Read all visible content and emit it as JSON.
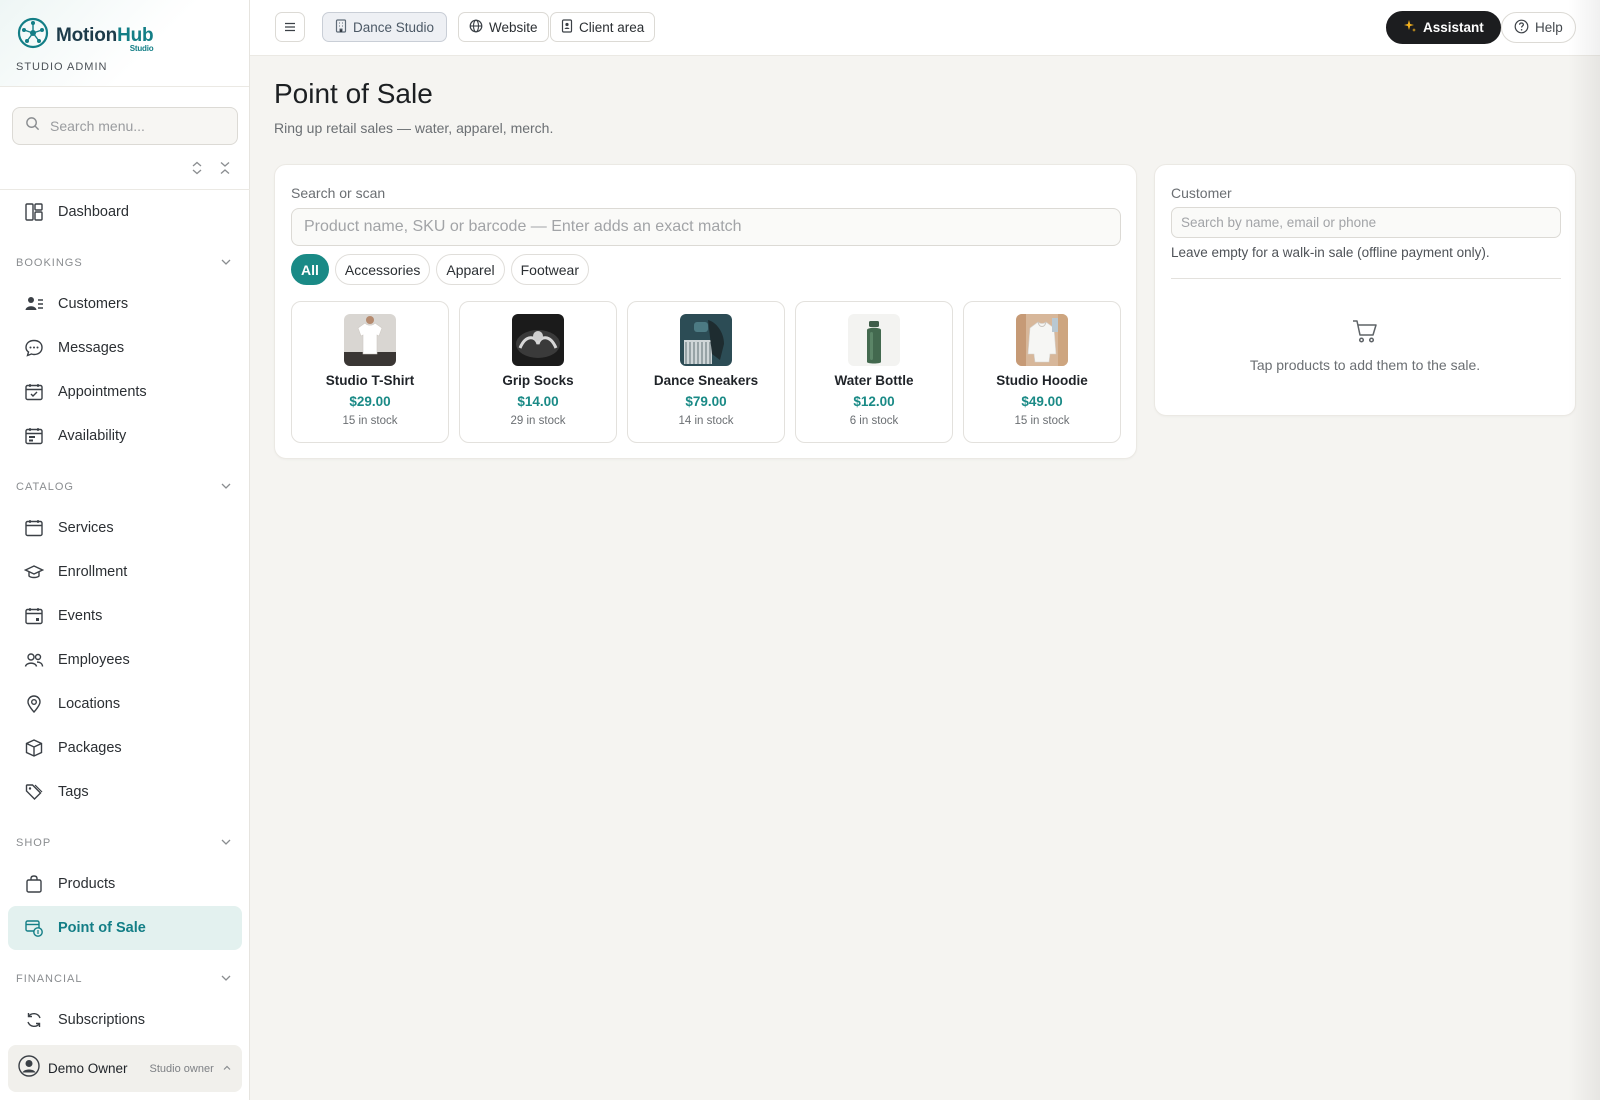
{
  "brand": {
    "name_a": "Motion",
    "name_b": "Hub",
    "sub": "Studio",
    "role": "STUDIO ADMIN"
  },
  "sidebar": {
    "search_placeholder": "Search menu...",
    "dashboard": "Dashboard",
    "sections": {
      "bookings": "BOOKINGS",
      "catalog": "CATALOG",
      "shop": "SHOP",
      "financial": "FINANCIAL"
    },
    "bookings": [
      "Customers",
      "Messages",
      "Appointments",
      "Availability"
    ],
    "catalog": [
      "Services",
      "Enrollment",
      "Events",
      "Employees",
      "Locations",
      "Packages",
      "Tags"
    ],
    "shop": [
      "Products",
      "Point of Sale"
    ],
    "financial": [
      "Subscriptions"
    ],
    "active_item": "Point of Sale",
    "user": {
      "name": "Demo Owner",
      "role": "Studio owner"
    }
  },
  "topbar": {
    "studio": "Dance Studio",
    "website": "Website",
    "client_area": "Client area",
    "assistant": "Assistant",
    "help": "Help"
  },
  "page": {
    "title": "Point of Sale",
    "subtitle": "Ring up retail sales — water, apparel, merch."
  },
  "pos": {
    "search_label": "Search or scan",
    "search_placeholder": "Product name, SKU or barcode — Enter adds an exact match",
    "categories": [
      "All",
      "Accessories",
      "Apparel",
      "Footwear"
    ],
    "active_category": "All",
    "products": [
      {
        "name": "Studio T-Shirt",
        "price": "$29.00",
        "stock": "15 in stock"
      },
      {
        "name": "Grip Socks",
        "price": "$14.00",
        "stock": "29 in stock"
      },
      {
        "name": "Dance Sneakers",
        "price": "$79.00",
        "stock": "14 in stock"
      },
      {
        "name": "Water Bottle",
        "price": "$12.00",
        "stock": "6 in stock"
      },
      {
        "name": "Studio Hoodie",
        "price": "$49.00",
        "stock": "15 in stock"
      }
    ]
  },
  "customer": {
    "label": "Customer",
    "placeholder": "Search by name, email or phone",
    "hint": "Leave empty for a walk-in sale (offline payment only).",
    "empty_cart": "Tap products to add them to the sale."
  },
  "colors": {
    "accent": "#1a8a86",
    "active_bg": "#e3f1ef",
    "assistant_bg": "#1c1d1f"
  }
}
